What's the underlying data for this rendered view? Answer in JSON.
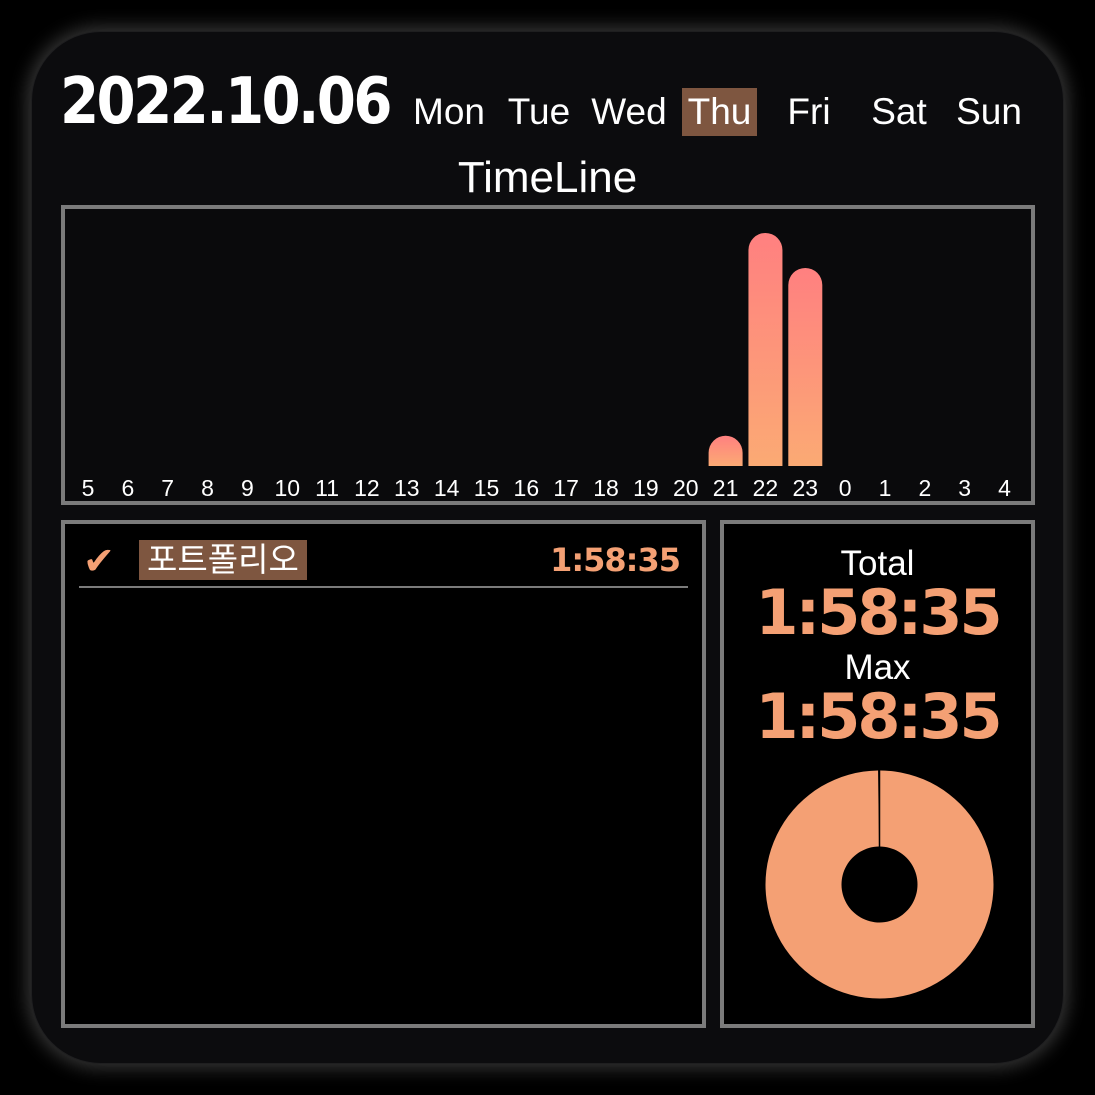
{
  "header": {
    "date": "2022.10.06",
    "days": [
      "Mon",
      "Tue",
      "Wed",
      "Thu",
      "Fri",
      "Sat",
      "Sun"
    ],
    "active_day": "Thu"
  },
  "timeline": {
    "title": "TimeLine"
  },
  "chart_data": {
    "type": "bar",
    "categories": [
      "5",
      "6",
      "7",
      "8",
      "9",
      "10",
      "11",
      "12",
      "13",
      "14",
      "15",
      "16",
      "17",
      "18",
      "19",
      "20",
      "21",
      "22",
      "23",
      "0",
      "1",
      "2",
      "3",
      "4"
    ],
    "values": [
      0,
      0,
      0,
      0,
      0,
      0,
      0,
      0,
      0,
      0,
      0,
      0,
      0,
      0,
      0,
      0,
      0.13,
      1.0,
      0.85,
      0,
      0,
      0,
      0,
      0
    ],
    "ylim": [
      0,
      1
    ],
    "gradient": [
      "#ff8080",
      "#fbaa74"
    ]
  },
  "tasks": [
    {
      "check": "✔",
      "name": "포트폴리오",
      "time": "1:58:35"
    }
  ],
  "stats": {
    "total_label": "Total",
    "total_value": "1:58:35",
    "max_label": "Max",
    "max_value": "1:58:35",
    "donut_fraction": 0.998
  },
  "colors": {
    "accent": "#f4a074",
    "active_day_bg": "#7e5640",
    "border": "#7b7b7b"
  }
}
